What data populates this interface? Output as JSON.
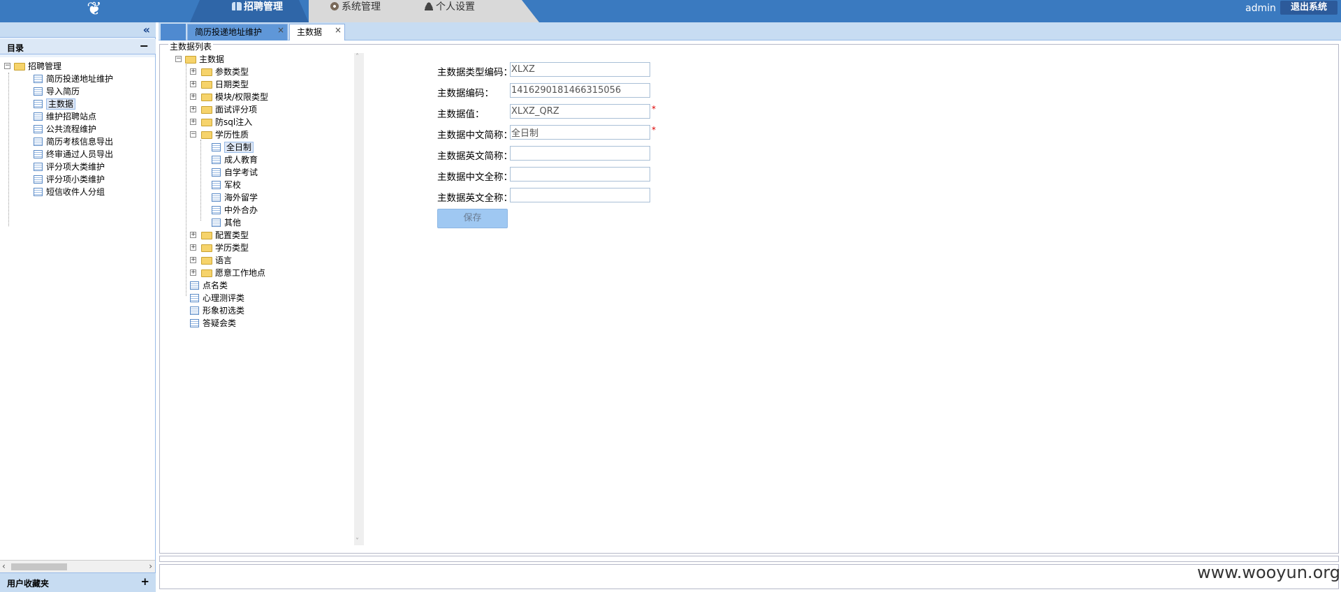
{
  "header": {
    "logo_icon": "emblem-icon",
    "nav": [
      {
        "label": "招聘管理",
        "icon": "users-icon",
        "active": true
      },
      {
        "label": "系统管理",
        "icon": "gear-icon"
      },
      {
        "label": "个人设置",
        "icon": "person-icon"
      }
    ],
    "user": "admin",
    "logout_label": "退出系统"
  },
  "sidebar": {
    "collapse_glyph": "«",
    "directory_label": "目录",
    "directory_toggle": "−",
    "root_label": "招聘管理",
    "items": [
      {
        "label": "简历投递地址维护"
      },
      {
        "label": "导入简历"
      },
      {
        "label": "主数据",
        "selected": true
      },
      {
        "label": "维护招聘站点"
      },
      {
        "label": "公共流程维护"
      },
      {
        "label": "简历考核信息导出"
      },
      {
        "label": "终审通过人员导出"
      },
      {
        "label": "评分项大类维护"
      },
      {
        "label": "评分项小类维护"
      },
      {
        "label": "短信收件人分组"
      }
    ],
    "favorites_label": "用户收藏夹",
    "favorites_toggle": "+"
  },
  "tabs": [
    {
      "label": "简历投递地址维护"
    },
    {
      "label": "主数据",
      "active": true
    }
  ],
  "panel": {
    "legend": "主数据列表",
    "tree": {
      "root": "主数据",
      "groups": [
        "参数类型",
        "日期类型",
        "模块/权限类型",
        "面试评分项",
        "防sql注入"
      ],
      "expanded_group": "学历性质",
      "expanded_children": [
        "全日制",
        "成人教育",
        "自学考试",
        "军校",
        "海外留学",
        "中外合办",
        "其他"
      ],
      "selected_child": "全日制",
      "groups_after": [
        "配置类型",
        "学历类型",
        "语言",
        "愿意工作地点"
      ],
      "leaves": [
        "点名类",
        "心理测评类",
        "形象初选类",
        "答疑会类"
      ]
    },
    "form": {
      "fields": [
        {
          "label": "主数据类型编码：",
          "value": "XLXZ",
          "required": false
        },
        {
          "label": "主数据编码：",
          "value": "1416290181466315056",
          "required": false
        },
        {
          "label": "主数据值：",
          "value": "XLXZ_QRZ",
          "required": true
        },
        {
          "label": "主数据中文简称：",
          "value": "全日制",
          "required": true
        },
        {
          "label": "主数据英文简称：",
          "value": "",
          "required": false
        },
        {
          "label": "主数据中文全称：",
          "value": "",
          "required": false
        },
        {
          "label": "主数据英文全称：",
          "value": "",
          "required": false
        }
      ],
      "required_mark": "*",
      "save_label": "保存"
    }
  },
  "watermark": "www.wooyun.org"
}
